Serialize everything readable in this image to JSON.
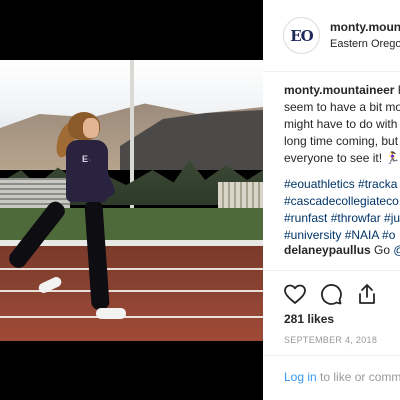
{
  "post": {
    "username": "monty.mount",
    "location": "Eastern Oregon",
    "avatar_text": "EO",
    "caption_user": "monty.mountaineer",
    "caption_lines": [
      " R",
      "seem to have a bit mo",
      "might have to do with",
      "long time coming, but",
      "everyone to see it! 🏃‍♀️💨"
    ],
    "hashtag_lines": [
      "#eouathletics #tracka",
      "#cascadecollegiateco",
      "#runfast #throwfar #ju",
      "#university #NAIA #o"
    ],
    "comment_user": "delaneypaullus",
    "comment_text": "Go",
    "comment_mention": " @",
    "likes": "281 likes",
    "date": "SEPTEMBER 4, 2018",
    "login_link": "Log in",
    "login_rest": " to like or comm"
  },
  "photo": {
    "shirt_text": "EO"
  },
  "icons": [
    "heart-icon",
    "comment-icon",
    "share-icon"
  ],
  "colors": {
    "link": "#003569",
    "login_link": "#3897f0",
    "muted": "#999999",
    "text": "#262626"
  }
}
